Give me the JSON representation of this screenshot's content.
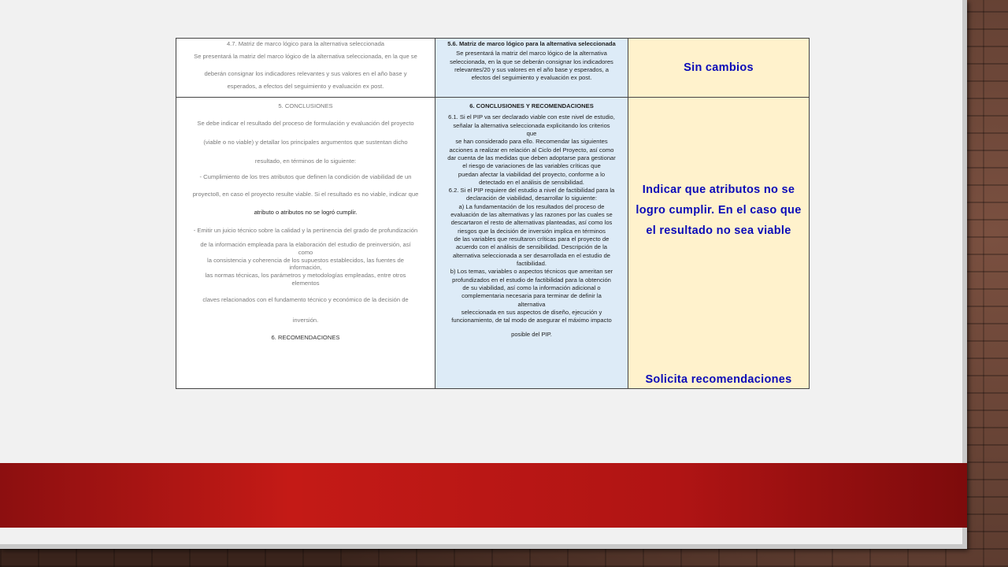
{
  "row1": {
    "col1": {
      "heading": "4.7. Matriz de marco lógico para la alternativa seleccionada",
      "line1": "Se presentará la matriz del marco lógico de la alternativa seleccionada, en la que se",
      "line2": "deberán consignar los indicadores relevantes y sus valores en el año base y",
      "line3": "esperados, a efectos del seguimiento y evaluación ex post."
    },
    "col2": {
      "heading": "5.6. Matriz de marco lógico para la alternativa seleccionada",
      "line1": "Se presentará la matriz del marco lógico de la alternativa",
      "line2": "seleccionada, en la que se deberán consignar los indicadores",
      "line3": "relevantes/20 y sus valores en el año base y esperados, a",
      "line4": "efectos del seguimiento y evaluación ex post."
    },
    "col3": {
      "comment": "Sin cambios"
    }
  },
  "row2": {
    "col1": {
      "heading": "5. CONCLUSIONES",
      "l1": "Se debe indicar el resultado del proceso de formulación y evaluación del proyecto",
      "l2": "(viable o no viable) y detallar los principales argumentos que sustentan dicho",
      "l3": "resultado, en términos de lo siguiente:",
      "l4": "- Cumplimiento de los tres atributos que definen la condición de viabilidad de un",
      "l5": "proyecto8, en caso el proyecto resulte viable. Si el resultado es no viable, indicar que",
      "l6": "atributo o atributos no se logró cumplir.",
      "l7": "- Emitir un juicio técnico sobre la calidad y la pertinencia del grado de profundización",
      "l8": "de la información empleada para la elaboración del estudio de preinversión, así",
      "l9": "como",
      "l10": "la consistencia y coherencia de los supuestos establecidos, las fuentes de",
      "l11": "información,",
      "l12": "las normas técnicas, los parámetros y metodologías empleadas, entre otros",
      "l13": "elementos",
      "l14": "claves relacionados con el fundamento técnico y económico de la decisión de",
      "l15": "inversión.",
      "l16": "6. RECOMENDACIONES"
    },
    "col2": {
      "heading": "6. CONCLUSIONES Y RECOMENDACIONES",
      "l1": "6.1. Si el PIP va ser declarado viable con este nivel de estudio,",
      "l2": "señalar la alternativa seleccionada explicitando los criterios",
      "l3": "que",
      "l4": "se han considerado para ello. Recomendar las siguientes",
      "l5": "acciones a realizar en relación al Ciclo del Proyecto, así como",
      "l6": "dar cuenta de las medidas que deben adoptarse para gestionar",
      "l7": "el riesgo de variaciones de las variables críticas que",
      "l8": "puedan afectar la viabilidad del proyecto, conforme a lo",
      "l9": "detectado en el análisis de sensibilidad.",
      "l10": "6.2. Si el PIP requiere del estudio a nivel de factibilidad para la",
      "l11": "declaración de viabilidad, desarrollar lo siguiente:",
      "l12": "a) La fundamentación de los resultados del proceso de",
      "l13": "evaluación de las alternativas y las razones por las cuales se",
      "l14": "descartaron el resto de alternativas planteadas, así como los",
      "l15": "riesgos que la decisión de inversión implica en términos",
      "l16": "de las variables que resultaron críticas para el proyecto de",
      "l17": "acuerdo con el análisis de sensibilidad. Descripción de la",
      "l18": "alternativa seleccionada a ser desarrollada en el estudio de",
      "l19": "factibilidad.",
      "l20": "b) Los temas, variables o aspectos técnicos que ameritan ser",
      "l21": "profundizados en el estudio de factibilidad para la obtención",
      "l22": "de su viabilidad, así como la información adicional o",
      "l23": "complementaria necesaria para terminar de definir la",
      "l24": "alternativa",
      "l25": "seleccionada en sus aspectos de diseño, ejecución y",
      "l26": "funcionamiento, de tal modo de asegurar el máximo impacto",
      "l27": "posible del PIP."
    },
    "col3": {
      "comment1_l1": "Indicar que atributos no se",
      "comment1_l2": "logro cumplir. En el caso que",
      "comment1_l3": "el resultado no sea viable",
      "comment2": "Solicita recomendaciones"
    }
  }
}
